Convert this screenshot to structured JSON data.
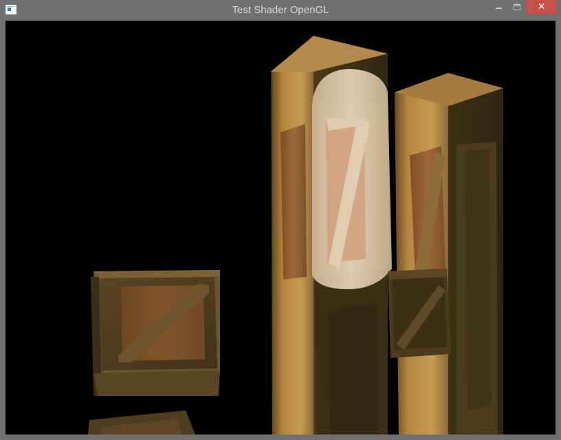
{
  "window": {
    "title": "Test Shader OpenGL",
    "icon": "window-app-icon",
    "controls": {
      "minimize": "minimize-icon",
      "maximize": "maximize-icon",
      "close": "✕"
    }
  },
  "colors": {
    "frame": "#707070",
    "close_button": "#c7504a",
    "viewport_background": "#000000",
    "wood_light": "#c9a063",
    "wood_dark": "#3c3017",
    "spotlight": "#d9c7aa"
  },
  "scene": {
    "objects": [
      "wooden crate",
      "wooden crate",
      "tall wooden crate pillar",
      "tall wooden crate pillar",
      "wooden crate"
    ]
  }
}
